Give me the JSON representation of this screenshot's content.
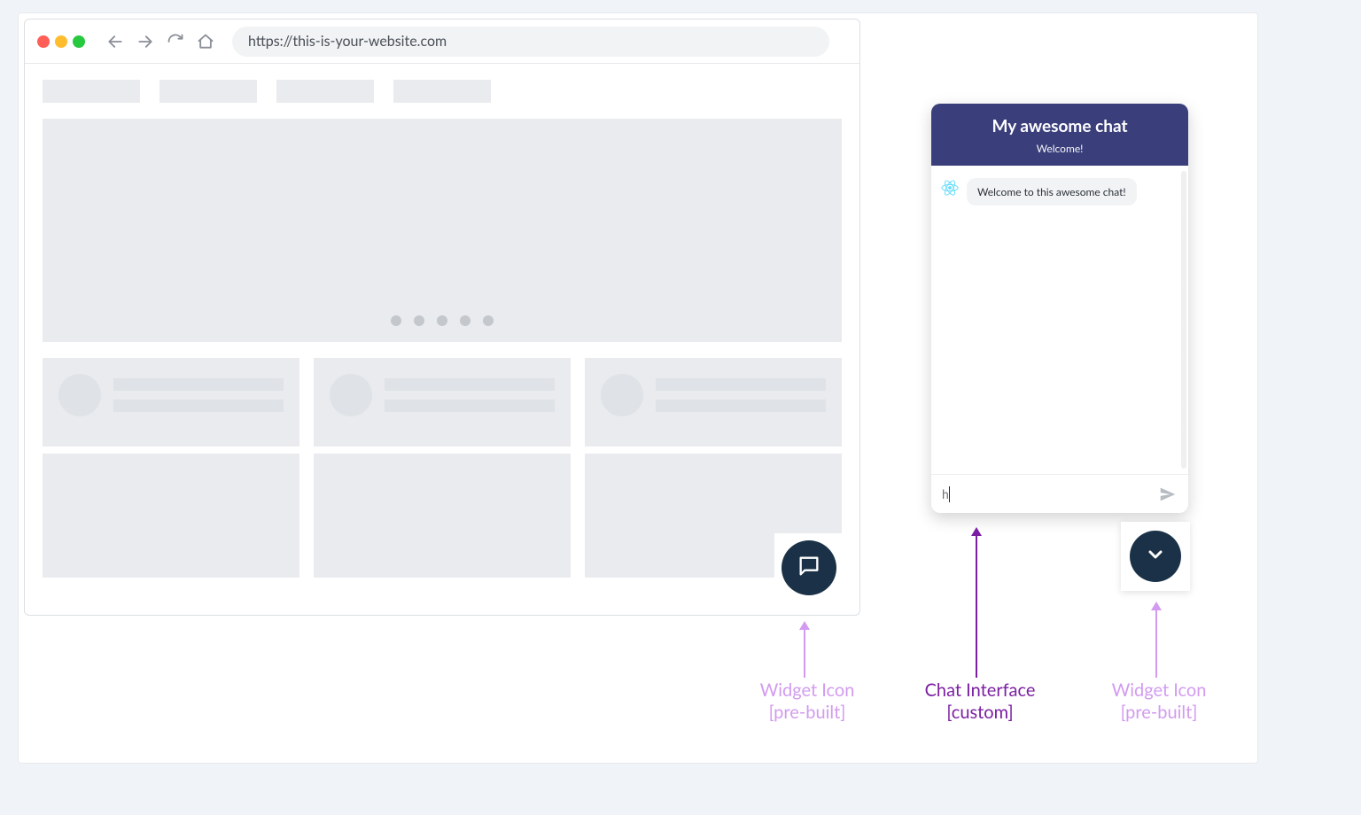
{
  "browser": {
    "url": "https://this-is-your-website.com"
  },
  "chat": {
    "title": "My awesome chat",
    "subtitle": "Welcome!",
    "message": "Welcome to this awesome chat!",
    "input_value": "h"
  },
  "annotations": {
    "widget_icon_left": {
      "line1": "Widget Icon",
      "line2": "[pre-built]"
    },
    "chat_interface": {
      "line1": "Chat Interface",
      "line2": "[custom]"
    },
    "widget_icon_right": {
      "line1": "Widget Icon",
      "line2": "[pre-built]"
    }
  }
}
